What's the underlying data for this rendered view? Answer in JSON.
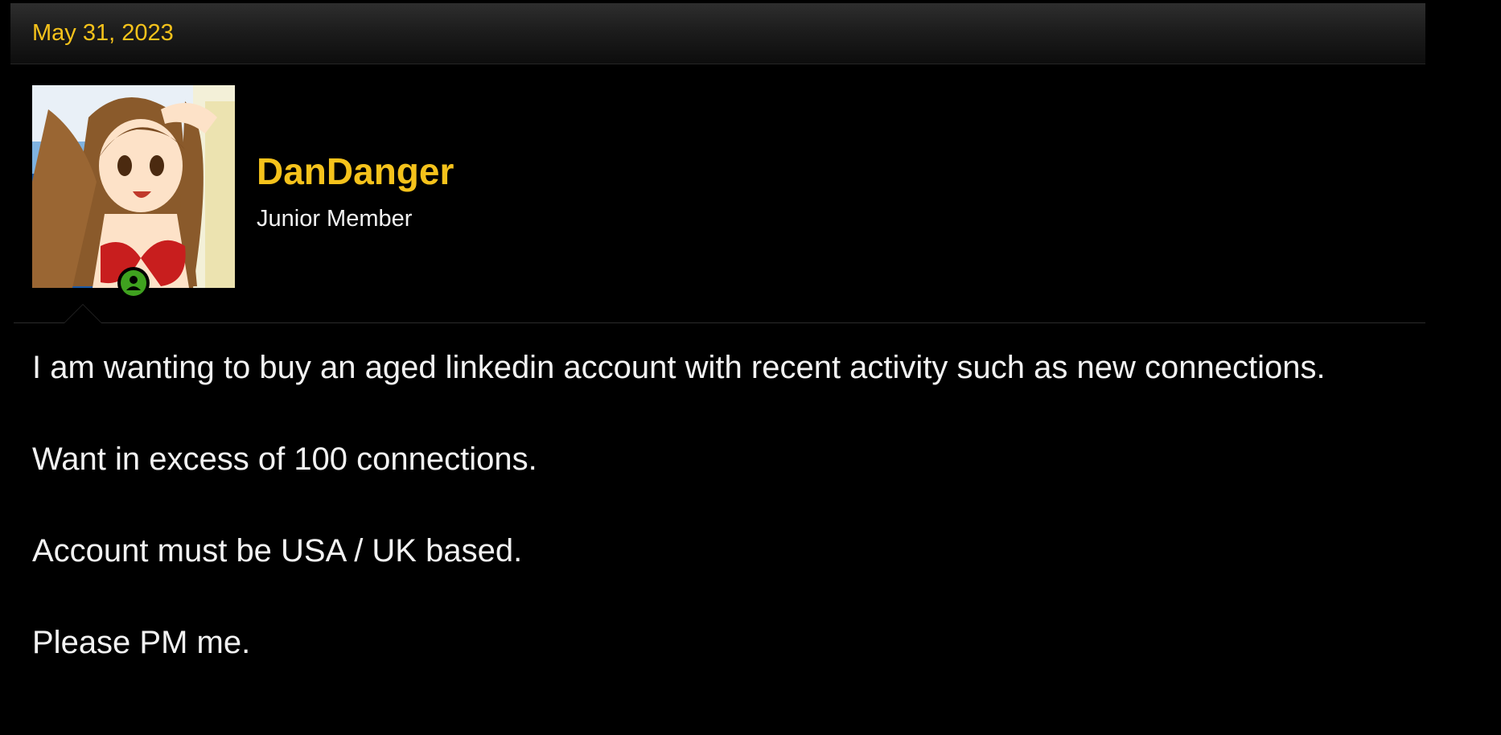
{
  "post": {
    "date": "May 31, 2023",
    "author": {
      "username": "DanDanger",
      "user_title": "Junior Member",
      "avatar_icon": "avatar-image",
      "online_status": "online",
      "online_icon": "user-online-icon"
    },
    "body": [
      "I am wanting to buy an aged linkedin account with recent activity such as new connections.",
      "Want in excess of 100 connections.",
      "Account must be USA / UK based.",
      "Please PM me."
    ]
  },
  "colors": {
    "accent": "#f5c21b",
    "text": "#f2f2f2",
    "background": "#000000",
    "online": "#3fa11f"
  }
}
